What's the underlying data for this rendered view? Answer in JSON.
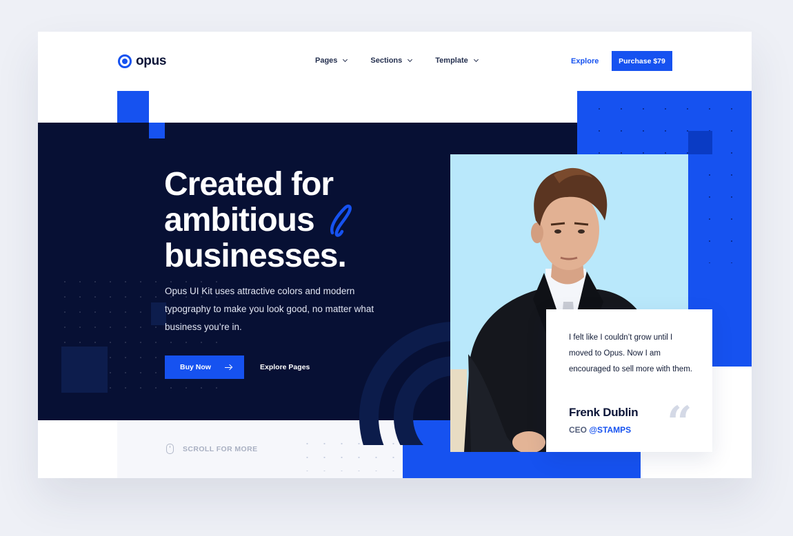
{
  "brand": {
    "name": "opus",
    "accent": "#1652f0",
    "navy": "#071034"
  },
  "nav": {
    "items": [
      {
        "label": "Pages",
        "icon": "chevron-down-icon"
      },
      {
        "label": "Sections",
        "icon": "chevron-down-icon"
      },
      {
        "label": "Template",
        "icon": "chevron-down-icon"
      }
    ],
    "explore_label": "Explore",
    "purchase_label": "Purchase $79"
  },
  "hero": {
    "headline_lines": [
      "Created for",
      "ambitious",
      "businesses."
    ],
    "subtext": "Opus UI Kit uses attractive colors and modern typography to make you look good, no matter what business you’re in.",
    "buy_label": "Buy Now",
    "explore_pages_label": "Explore Pages",
    "scroll_label": "SCROLL FOR MORE"
  },
  "testimonial": {
    "quote": "I felt like I couldn’t grow until I moved to Opus. Now I am encouraged to sell more with them.",
    "author": "Frenk Dublin",
    "role": "CEO",
    "company": "@STAMPS",
    "quote_icon": "quote-mark-icon"
  }
}
